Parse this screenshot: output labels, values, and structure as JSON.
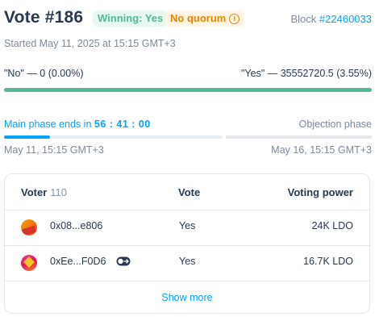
{
  "header": {
    "title": "Vote #186",
    "winning_badge": "Winning: Yes",
    "quorum_badge": "No quorum",
    "quorum_icon": "info-icon",
    "block_label": "Block",
    "block_number": "#22460033"
  },
  "started": "Started May 11, 2025 at 15:15 GMT+3",
  "results": {
    "no_text": "\"No\" — 0 (0.00%)",
    "yes_text": "\"Yes\" — 35552720.5 (3.55%)",
    "yes_share": 1.0,
    "bar_color": "#53BA95"
  },
  "phase": {
    "main_prefix": "Main phase ends in",
    "countdown": "56 : 41 : 00",
    "objection_label": "Objection phase",
    "start_date": "May 11, 15:15 GMT+3",
    "end_date": "May 16, 15:15 GMT+3",
    "main_progress": 0.21,
    "accent": "#00A3FF"
  },
  "table": {
    "col_voter": "Voter",
    "voter_count": "110",
    "col_vote": "Vote",
    "col_power": "Voting power",
    "rows": [
      {
        "address": "0x08...e806",
        "vote": "Yes",
        "power": "24K LDO",
        "delegate": false
      },
      {
        "address": "0xEe...F0D6",
        "vote": "Yes",
        "power": "16.7K LDO",
        "delegate": true
      }
    ],
    "show_more": "Show more"
  }
}
